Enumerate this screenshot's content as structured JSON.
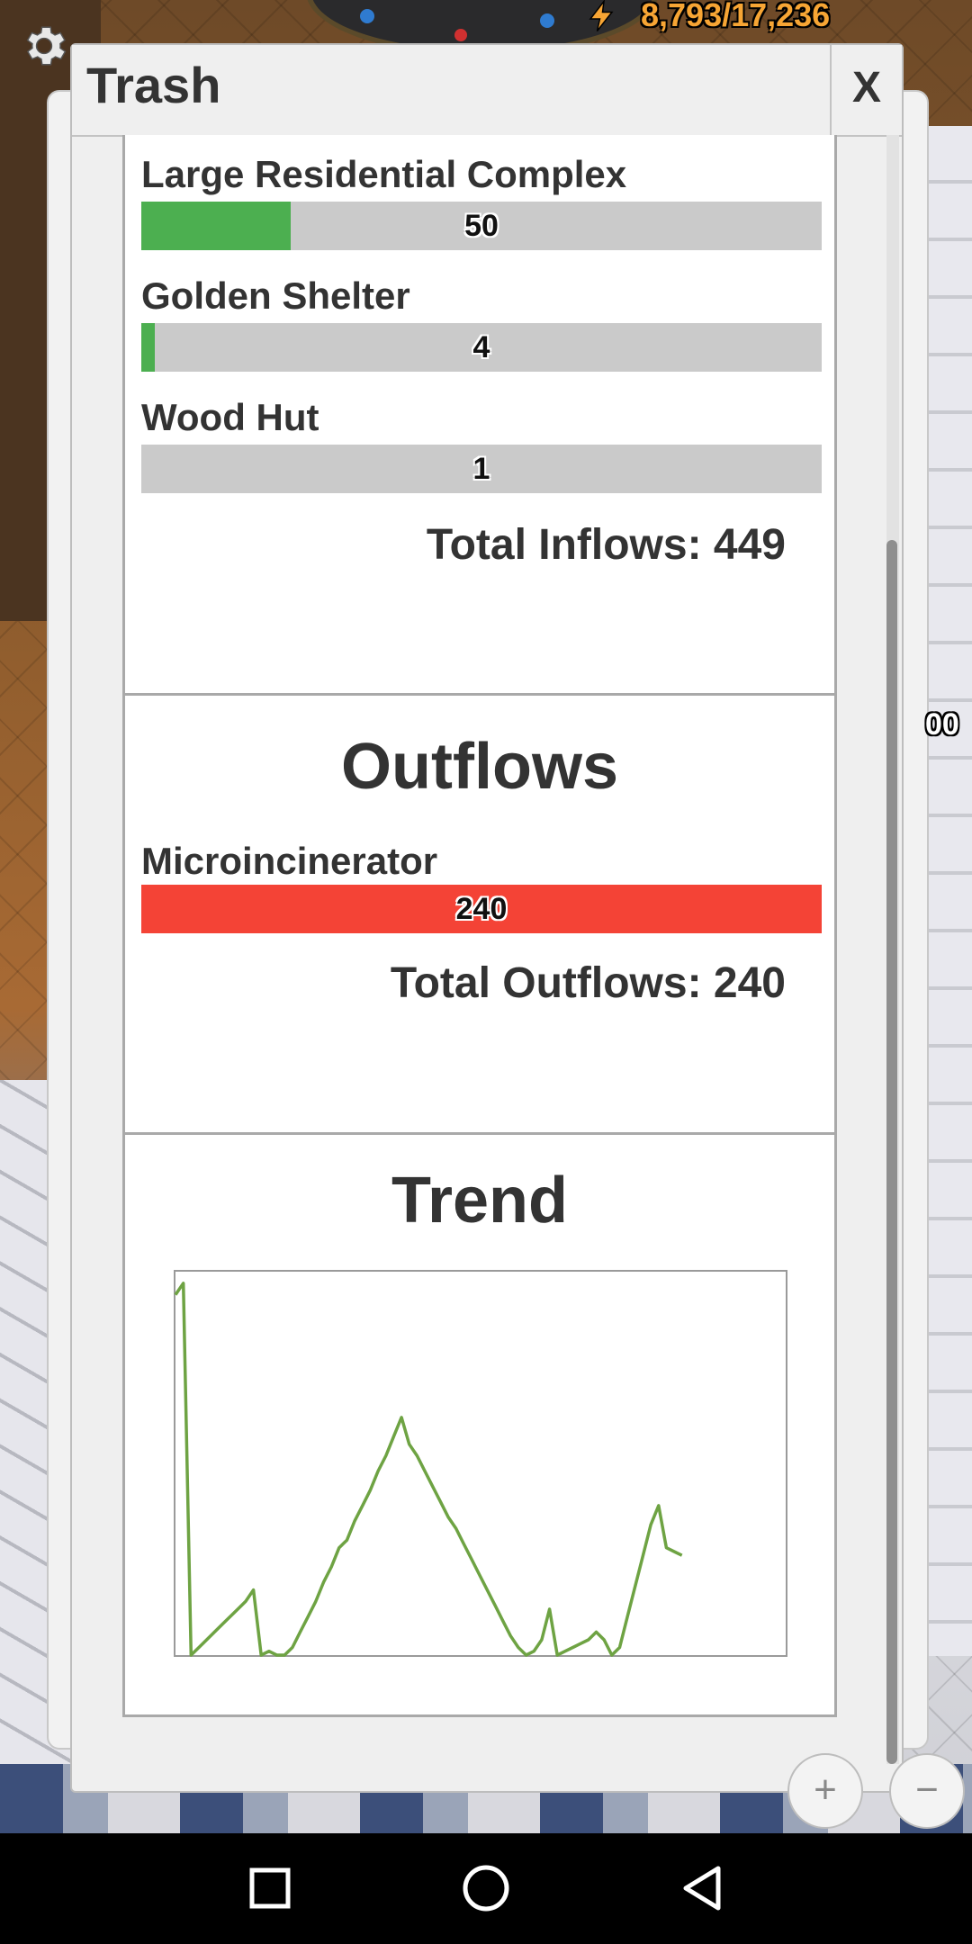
{
  "hud": {
    "energy": "8,793/17,236",
    "side_number": "00",
    "zoom_in_label": "+",
    "zoom_out_label": "−"
  },
  "popup": {
    "title": "Trash",
    "close_label": "X"
  },
  "inflows": {
    "items": [
      {
        "label": "Large Residential Complex",
        "value": "50",
        "fill_fraction": 0.22,
        "color": "#4caf50"
      },
      {
        "label": "Golden Shelter",
        "value": "4",
        "fill_fraction": 0.02,
        "color": "#4caf50"
      },
      {
        "label": "Wood Hut",
        "value": "1",
        "fill_fraction": 0.0,
        "color": "#4caf50"
      }
    ],
    "total": "Total Inflows: 449"
  },
  "outflows": {
    "heading": "Outflows",
    "items": [
      {
        "label": "Microincinerator",
        "value": "240",
        "fill_fraction": 1.0,
        "color": "#f44336"
      }
    ],
    "total": "Total Outflows: 240"
  },
  "trend": {
    "heading": "Trend",
    "line_color": "#6ea343"
  },
  "chart_data": {
    "type": "line",
    "title": "Trend",
    "xlabel": "",
    "ylabel": "",
    "ylim": [
      0,
      100
    ],
    "x": [
      0,
      1,
      2,
      3,
      4,
      5,
      6,
      7,
      8,
      9,
      10,
      11,
      12,
      13,
      14,
      15,
      16,
      17,
      18,
      19,
      20,
      21,
      22,
      23,
      24,
      25,
      26,
      27,
      28,
      29,
      30,
      31,
      32,
      33,
      34,
      35,
      36,
      37,
      38,
      39,
      40,
      41,
      42,
      43,
      44,
      45,
      46,
      47,
      48,
      49,
      50,
      51,
      52,
      53,
      54,
      55,
      56,
      57,
      58,
      59,
      60,
      61,
      62,
      63,
      64,
      65,
      66,
      67,
      68,
      69,
      70,
      71,
      72,
      73,
      74,
      75,
      76,
      77,
      78,
      79,
      80
    ],
    "series": [
      {
        "values": [
          94,
          97,
          0,
          2,
          4,
          6,
          8,
          10,
          12,
          14,
          17,
          0,
          1,
          0,
          0,
          2,
          6,
          10,
          14,
          19,
          23,
          28,
          30,
          35,
          39,
          43,
          48,
          52,
          57,
          62,
          55,
          52,
          48,
          44,
          40,
          36,
          33,
          29,
          25,
          21,
          17,
          13,
          9,
          5,
          2,
          0,
          1,
          4,
          12,
          0,
          1,
          2,
          3,
          4,
          6,
          4,
          0,
          2,
          10,
          18,
          26,
          34,
          39,
          28,
          27,
          26
        ],
        "color": "#6ea343"
      }
    ]
  },
  "nav": {
    "recents_icon": "square-icon",
    "home_icon": "circle-icon",
    "back_icon": "triangle-back-icon"
  }
}
